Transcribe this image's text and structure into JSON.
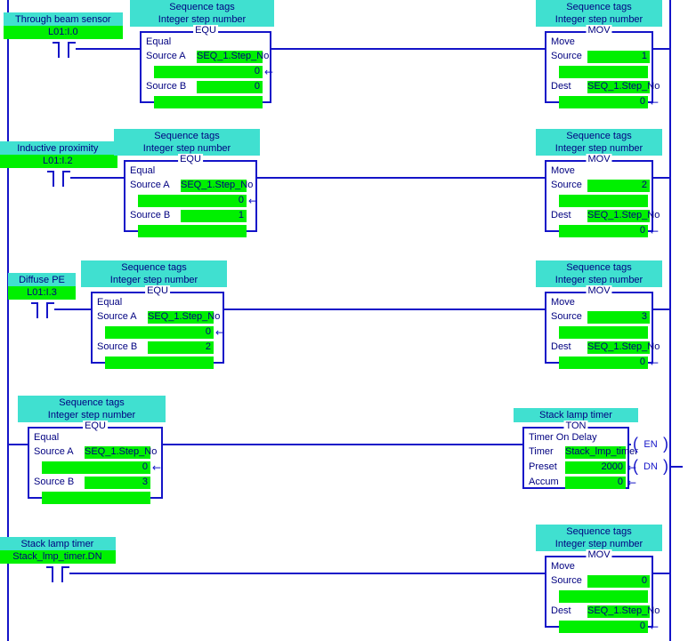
{
  "meta": {
    "colors": {
      "wire": "#1414c8",
      "tag_comment_bg": "#40e0d0",
      "operand_bg": "#00f000",
      "text": "#000080",
      "background": "#ffffff"
    }
  },
  "rungs": [
    {
      "id": "rung-0",
      "contact": {
        "comment": "Through beam sensor",
        "operand": "L01:I.0",
        "type": "xic-contact"
      },
      "input_block": {
        "comment_line1": "Sequence tags",
        "comment_line2": "Integer step number",
        "mnemonic": "EQU",
        "name": "Equal",
        "fields": [
          {
            "label": "Source A",
            "value": "SEQ_1.Step_No",
            "align": "center",
            "arrow": false
          },
          {
            "label": "",
            "value": "0",
            "align": "right",
            "arrow": true
          },
          {
            "label": "Source B",
            "value": "0",
            "align": "right",
            "arrow": false
          },
          {
            "label": "",
            "value": "",
            "align": "right",
            "arrow": false
          }
        ]
      },
      "output_block": {
        "comment_line1": "Sequence tags",
        "comment_line2": "Integer step number",
        "mnemonic": "MOV",
        "name": "Move",
        "fields": [
          {
            "label": "Source",
            "value": "1",
            "align": "right",
            "arrow": false
          },
          {
            "label": "",
            "value": "",
            "align": "right",
            "arrow": false
          },
          {
            "label": "Dest",
            "value": "SEQ_1.Step_No",
            "align": "center",
            "arrow": false
          },
          {
            "label": "",
            "value": "0",
            "align": "right",
            "arrow": true
          }
        ]
      }
    },
    {
      "id": "rung-1",
      "contact": {
        "comment": "Inductive proximity",
        "operand": "L01:I.2",
        "type": "xic-contact"
      },
      "input_block": {
        "comment_line1": "Sequence tags",
        "comment_line2": "Integer step number",
        "mnemonic": "EQU",
        "name": "Equal",
        "fields": [
          {
            "label": "Source A",
            "value": "SEQ_1.Step_No",
            "align": "center",
            "arrow": false
          },
          {
            "label": "",
            "value": "0",
            "align": "right",
            "arrow": true
          },
          {
            "label": "Source B",
            "value": "1",
            "align": "right",
            "arrow": false
          },
          {
            "label": "",
            "value": "",
            "align": "right",
            "arrow": false
          }
        ]
      },
      "output_block": {
        "comment_line1": "Sequence tags",
        "comment_line2": "Integer step number",
        "mnemonic": "MOV",
        "name": "Move",
        "fields": [
          {
            "label": "Source",
            "value": "2",
            "align": "right",
            "arrow": false
          },
          {
            "label": "",
            "value": "",
            "align": "right",
            "arrow": false
          },
          {
            "label": "Dest",
            "value": "SEQ_1.Step_No",
            "align": "center",
            "arrow": false
          },
          {
            "label": "",
            "value": "0",
            "align": "right",
            "arrow": true
          }
        ]
      }
    },
    {
      "id": "rung-2",
      "contact": {
        "comment": "Diffuse PE",
        "operand": "L01:I.3",
        "type": "xic-contact"
      },
      "input_block": {
        "comment_line1": "Sequence tags",
        "comment_line2": "Integer step number",
        "mnemonic": "EQU",
        "name": "Equal",
        "fields": [
          {
            "label": "Source A",
            "value": "SEQ_1.Step_No",
            "align": "center",
            "arrow": false
          },
          {
            "label": "",
            "value": "0",
            "align": "right",
            "arrow": true
          },
          {
            "label": "Source B",
            "value": "2",
            "align": "right",
            "arrow": false
          },
          {
            "label": "",
            "value": "",
            "align": "right",
            "arrow": false
          }
        ]
      },
      "output_block": {
        "comment_line1": "Sequence tags",
        "comment_line2": "Integer step number",
        "mnemonic": "MOV",
        "name": "Move",
        "fields": [
          {
            "label": "Source",
            "value": "3",
            "align": "right",
            "arrow": false
          },
          {
            "label": "",
            "value": "",
            "align": "right",
            "arrow": false
          },
          {
            "label": "Dest",
            "value": "SEQ_1.Step_No",
            "align": "center",
            "arrow": false
          },
          {
            "label": "",
            "value": "0",
            "align": "right",
            "arrow": true
          }
        ]
      }
    },
    {
      "id": "rung-3",
      "contact": null,
      "input_block": {
        "comment_line1": "Sequence tags",
        "comment_line2": "Integer step number",
        "mnemonic": "EQU",
        "name": "Equal",
        "fields": [
          {
            "label": "Source A",
            "value": "SEQ_1.Step_No",
            "align": "center",
            "arrow": false
          },
          {
            "label": "",
            "value": "0",
            "align": "right",
            "arrow": true
          },
          {
            "label": "Source B",
            "value": "3",
            "align": "right",
            "arrow": false
          },
          {
            "label": "",
            "value": "",
            "align": "right",
            "arrow": false
          }
        ]
      },
      "output_block": {
        "comment_line1": "Stack lamp timer",
        "comment_line2": "",
        "mnemonic": "TON",
        "name": "Timer On Delay",
        "fields": [
          {
            "label": "Timer",
            "value": "Stack_lmp_timer",
            "align": "center",
            "arrow": false
          },
          {
            "label": "Preset",
            "value": "2000",
            "align": "right",
            "arrow": true
          },
          {
            "label": "Accum",
            "value": "0",
            "align": "right",
            "arrow": true
          }
        ],
        "coils": [
          {
            "label": "EN"
          },
          {
            "label": "DN"
          }
        ]
      }
    },
    {
      "id": "rung-4",
      "contact": {
        "comment": "Stack lamp timer",
        "operand": "Stack_lmp_timer.DN",
        "type": "xic-contact"
      },
      "input_block": null,
      "output_block": {
        "comment_line1": "Sequence tags",
        "comment_line2": "Integer step number",
        "mnemonic": "MOV",
        "name": "Move",
        "fields": [
          {
            "label": "Source",
            "value": "0",
            "align": "right",
            "arrow": false
          },
          {
            "label": "",
            "value": "",
            "align": "right",
            "arrow": false
          },
          {
            "label": "Dest",
            "value": "SEQ_1.Step_No",
            "align": "center",
            "arrow": false
          },
          {
            "label": "",
            "value": "0",
            "align": "right",
            "arrow": true
          }
        ]
      }
    }
  ]
}
